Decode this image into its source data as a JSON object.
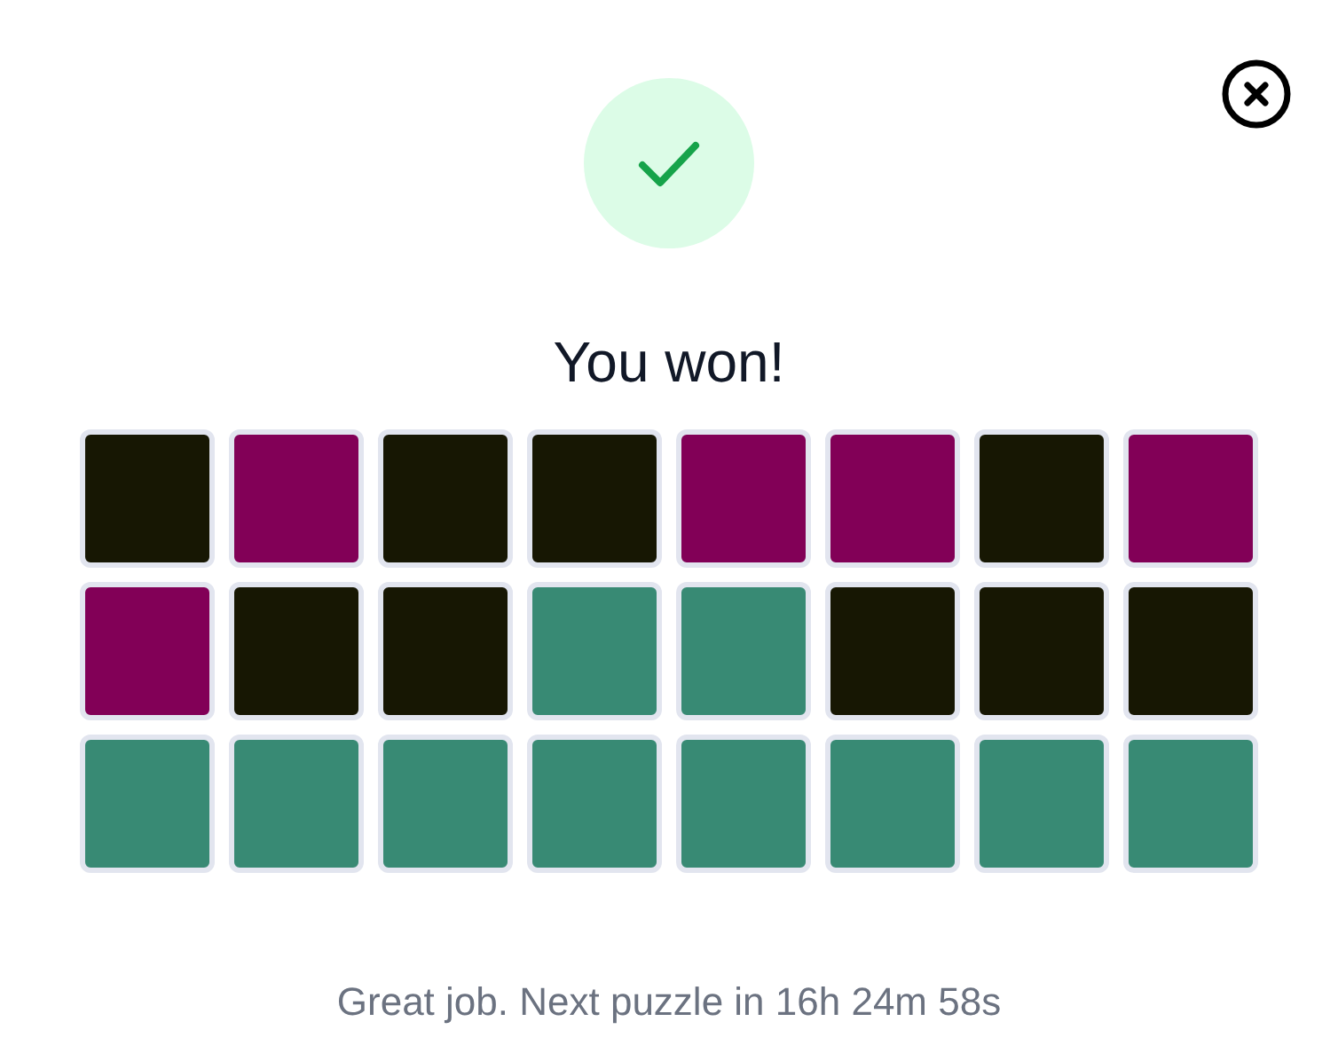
{
  "title": "You won!",
  "grid": [
    [
      {
        "color": "#171703"
      },
      {
        "color": "#820057"
      },
      {
        "color": "#171703"
      },
      {
        "color": "#171703"
      },
      {
        "color": "#820057"
      },
      {
        "color": "#820057"
      },
      {
        "color": "#171703"
      },
      {
        "color": "#820057"
      }
    ],
    [
      {
        "color": "#820057"
      },
      {
        "color": "#171703"
      },
      {
        "color": "#171703"
      },
      {
        "color": "#388a74"
      },
      {
        "color": "#388a74"
      },
      {
        "color": "#171703"
      },
      {
        "color": "#171703"
      },
      {
        "color": "#171703"
      }
    ],
    [
      {
        "color": "#388a74"
      },
      {
        "color": "#388a74"
      },
      {
        "color": "#388a74"
      },
      {
        "color": "#388a74"
      },
      {
        "color": "#388a74"
      },
      {
        "color": "#388a74"
      },
      {
        "color": "#388a74"
      },
      {
        "color": "#388a74"
      }
    ]
  ],
  "message": "Great job. Next puzzle in 16h 24m 58s"
}
